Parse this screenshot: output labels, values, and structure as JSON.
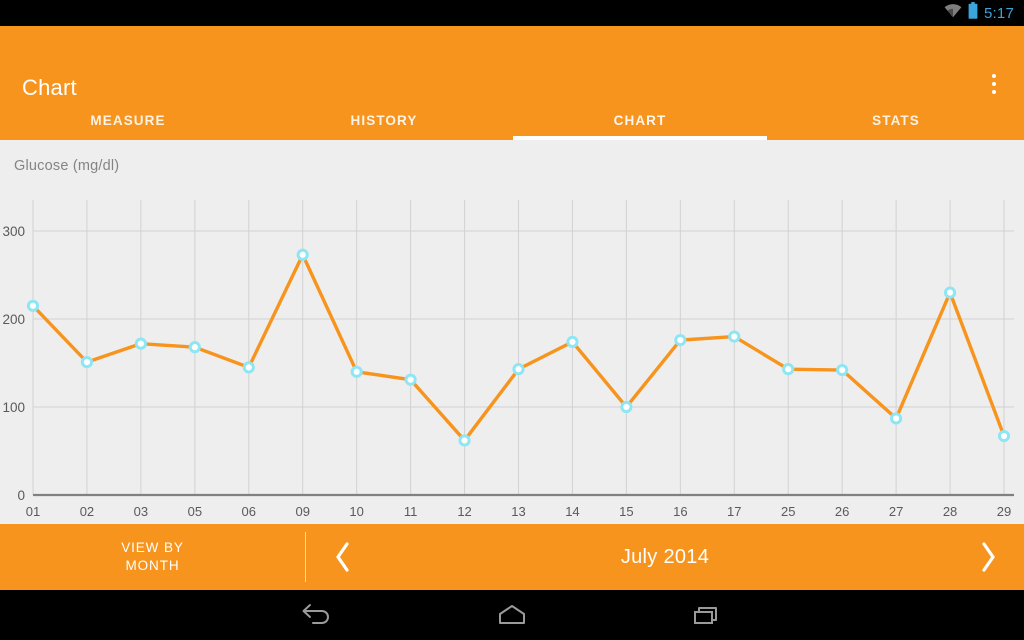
{
  "status_bar": {
    "wifi_icon": "wifi-icon",
    "battery_icon": "battery-icon",
    "time": "5:17",
    "time_color": "#3BA4DB",
    "battery_color": "#3BA4DB"
  },
  "action_bar": {
    "title": "Chart",
    "overflow_icon": "overflow-menu-icon",
    "accent_color": "#F7941E"
  },
  "tabs": [
    {
      "label": "MEASURE",
      "active": false
    },
    {
      "label": "HISTORY",
      "active": false
    },
    {
      "label": "CHART",
      "active": true
    },
    {
      "label": "STATS",
      "active": false
    }
  ],
  "chart_panel": {
    "title": "Glucose (mg/dl)",
    "background": "#EEEEEE"
  },
  "bottom_bar": {
    "view_by_line1": "VIEW BY",
    "view_by_line2": "MONTH",
    "prev_icon": "chevron-left-icon",
    "next_icon": "chevron-right-icon",
    "period": "July 2014"
  },
  "nav_bar": {
    "back_icon": "back-icon",
    "home_icon": "home-icon",
    "recents_icon": "recents-icon"
  },
  "chart_data": {
    "type": "line",
    "title": "Glucose (mg/dl)",
    "xlabel": "",
    "ylabel": "Glucose (mg/dl)",
    "categories": [
      "01",
      "02",
      "03",
      "05",
      "06",
      "09",
      "10",
      "11",
      "12",
      "13",
      "14",
      "15",
      "16",
      "17",
      "25",
      "26",
      "27",
      "28",
      "29"
    ],
    "values": [
      215,
      151,
      172,
      168,
      145,
      273,
      140,
      131,
      62,
      143,
      174,
      100,
      176,
      180,
      143,
      142,
      87,
      230,
      67
    ],
    "yticks": [
      0,
      100,
      200,
      300
    ],
    "ylim": [
      0,
      345
    ],
    "grid": true,
    "legend": "none",
    "line_color": "#F7941E",
    "marker_fill": "#FFFFFF",
    "marker_stroke": "#8EE6F5",
    "axis_color": "#808080",
    "grid_color": "#D2D2D2",
    "tick_label_color": "#5A5A5A"
  }
}
